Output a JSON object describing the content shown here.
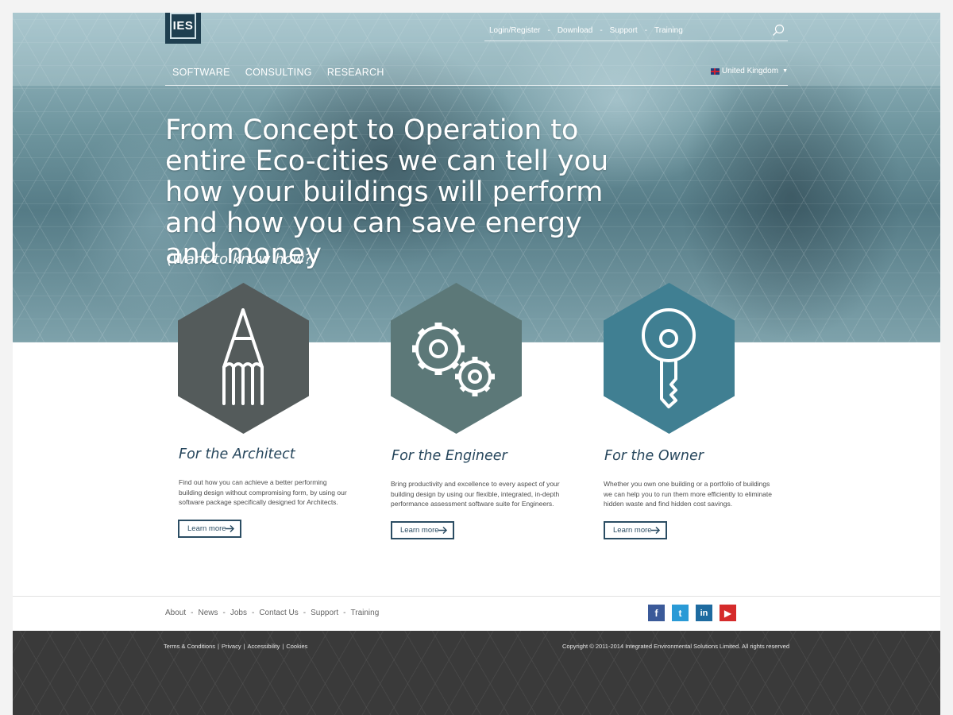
{
  "brand": {
    "logo_text": "IES"
  },
  "utility_nav": [
    "Login/Register",
    "Download",
    "Support",
    "Training"
  ],
  "main_nav": [
    "SOFTWARE",
    "CONSULTING",
    "RESEARCH"
  ],
  "country_selector": {
    "label": "United Kingdom"
  },
  "hero": {
    "headline": "From Concept to Operation to entire Eco-cities we can tell you how your buildings will perform and how you can save energy and money",
    "subheadline": "(Want to know how?)"
  },
  "cards": [
    {
      "title": "For the Architect",
      "text": "Find out how you can achieve a better performing building design without compromising form, by using our software package specifically designed for Architects.",
      "button": "Learn more",
      "icon": "pencil-icon",
      "color": "#545b5b"
    },
    {
      "title": "For the Engineer",
      "text": "Bring productivity and excellence to every aspect of your building design by using our flexible, integrated, in-depth performance assessment software suite for Engineers.",
      "button": "Learn more",
      "icon": "gears-icon",
      "color": "#5c7878"
    },
    {
      "title": "For the Owner",
      "text": "Whether you own one building or a portfolio of buildings we can help you to run them more efficiently to eliminate hidden waste and find hidden cost savings.",
      "button": "Learn more",
      "icon": "key-icon",
      "color": "#407f92"
    }
  ],
  "footer_links": [
    "About",
    "News",
    "Jobs",
    "Contact Us",
    "Support",
    "Training"
  ],
  "social": [
    {
      "name": "facebook-icon",
      "glyph": "f",
      "color": "#3b5a99"
    },
    {
      "name": "twitter-icon",
      "glyph": "t",
      "color": "#2a9ad6"
    },
    {
      "name": "linkedin-icon",
      "glyph": "in",
      "color": "#1e6ba0"
    },
    {
      "name": "youtube-icon",
      "glyph": "▶",
      "color": "#d52b2b"
    }
  ],
  "legal_links": [
    "Terms & Conditions",
    "Privacy",
    "Accessibility",
    "Cookies"
  ],
  "copyright": "Copyright © 2011-2014 Integrated Environmental Solutions Limited. All rights reserved"
}
